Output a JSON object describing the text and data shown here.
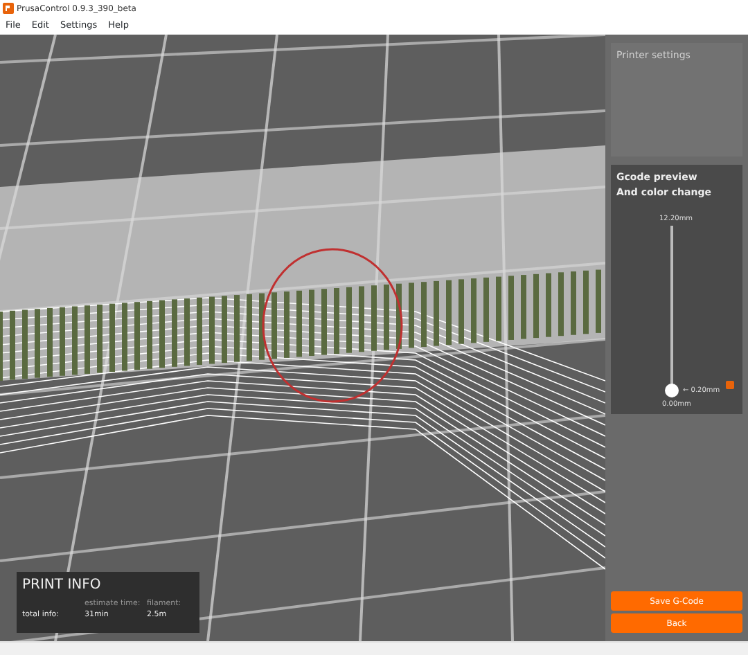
{
  "window": {
    "title": "PrusaControl 0.9.3_390_beta"
  },
  "menu": [
    "File",
    "Edit",
    "Settings",
    "Help"
  ],
  "printer_settings": {
    "title": "Printer settings"
  },
  "gcode_preview": {
    "title": "Gcode preview",
    "subtitle": "And color change",
    "top_label": "12.20mm",
    "bottom_label": "0.00mm",
    "current_label": "← 0.20mm",
    "slider": {
      "level": 0.0
    }
  },
  "print_info": {
    "title": "PRINT INFO",
    "row_label": "total info:",
    "columns": [
      {
        "header": "estimate time:",
        "value": "31min"
      },
      {
        "header": "filament:",
        "value": "2.5m"
      }
    ]
  },
  "buttons": [
    "Save G-Code",
    "Back"
  ]
}
